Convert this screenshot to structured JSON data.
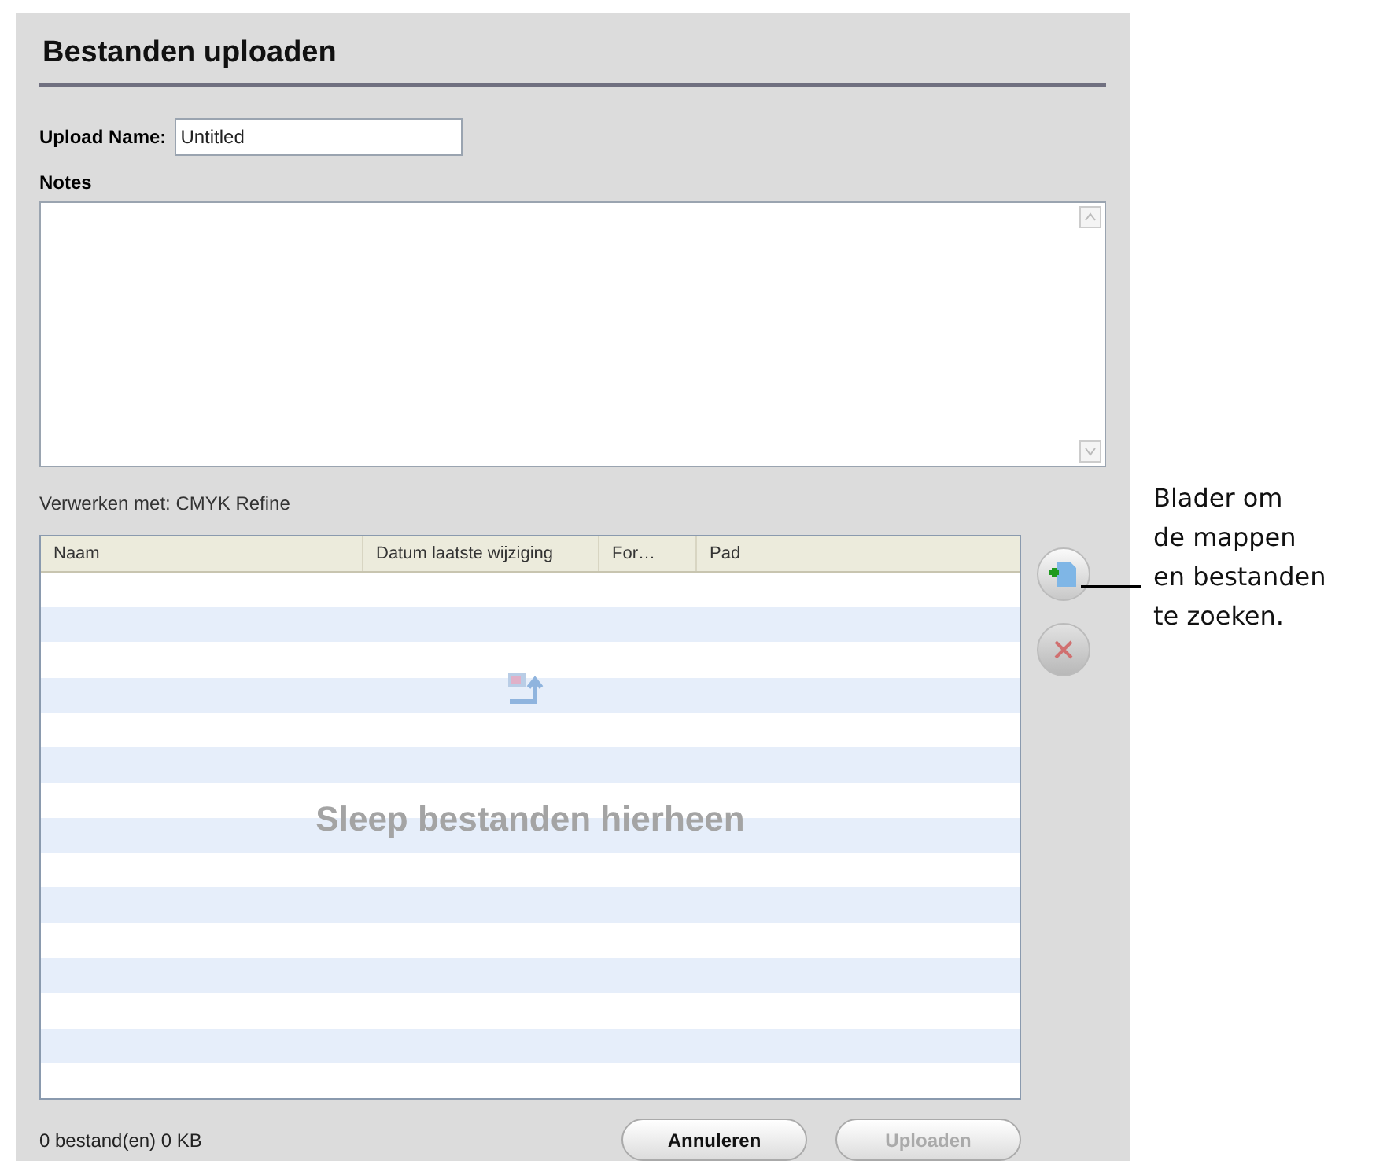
{
  "title": "Bestanden uploaden",
  "upload_name": {
    "label": "Upload Name:",
    "value": "Untitled"
  },
  "notes": {
    "label": "Notes"
  },
  "process_with": "Verwerken met: CMYK Refine",
  "table": {
    "columns": [
      "Naam",
      "Datum laatste wijziging",
      "For…",
      "Pad"
    ],
    "drop_hint": "Sleep bestanden hierheen"
  },
  "status": "0 bestand(en) 0 KB",
  "buttons": [
    {
      "label": "Annuleren",
      "disabled": false
    },
    {
      "label": "Uploaden",
      "disabled": true
    }
  ],
  "callout": [
    "Blader om",
    "de mappen",
    "en bestanden",
    "te zoeken."
  ]
}
